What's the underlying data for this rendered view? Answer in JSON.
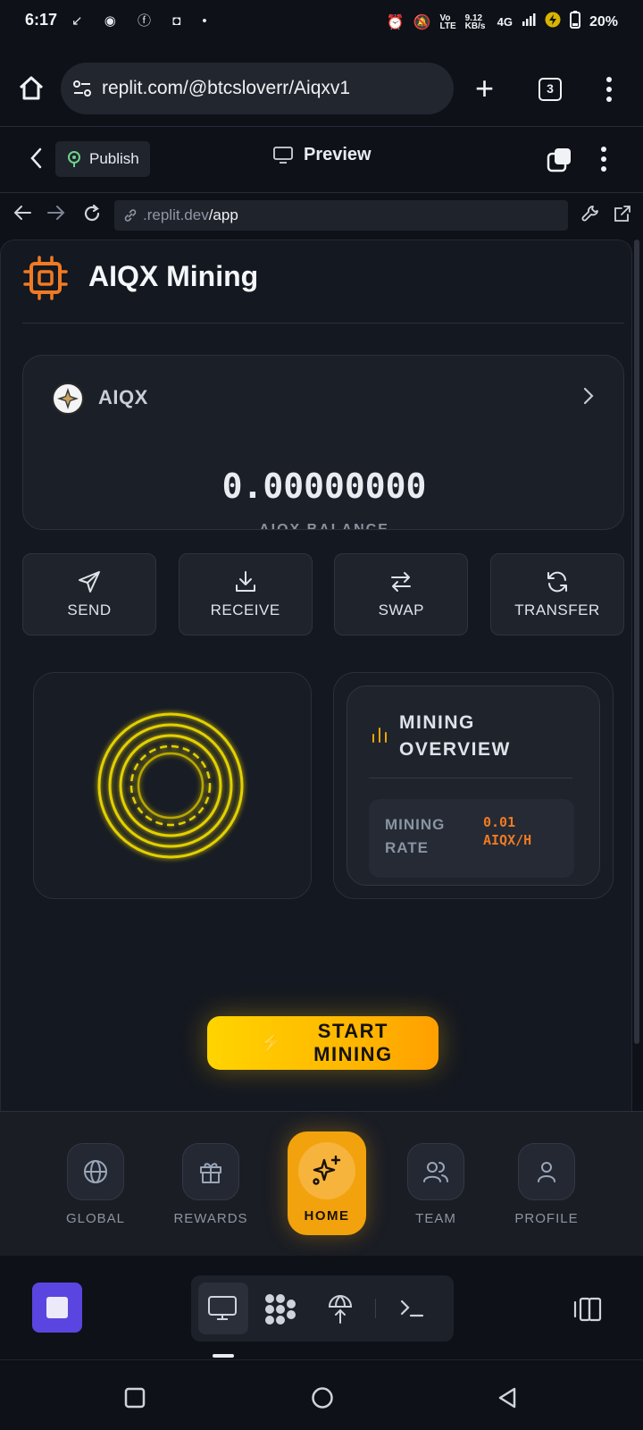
{
  "status_bar": {
    "time": "6:17",
    "battery": "20%",
    "net_speed": "9.12 KB/s",
    "network": "4G"
  },
  "browser": {
    "url": "replit.com/@btcsloverr/Aiqxv1",
    "tab_count": "3"
  },
  "replit_header": {
    "publish_label": "Publish",
    "preview_label": "Preview"
  },
  "webview": {
    "url_prefix": ".replit.dev",
    "url_path": "/app"
  },
  "app": {
    "title": "AIQX Mining",
    "balance": {
      "coin": "AIQX",
      "amount": "0.00000000",
      "label": "AIQX BALANCE"
    },
    "actions": [
      {
        "label": "SEND",
        "icon": "send-icon"
      },
      {
        "label": "RECEIVE",
        "icon": "download-icon"
      },
      {
        "label": "SWAP",
        "icon": "swap-icon"
      },
      {
        "label": "TRANSFER",
        "icon": "refresh-icon"
      }
    ],
    "overview": {
      "title": "MINING OVERVIEW",
      "rate_label": "MINING RATE",
      "rate_value": "0.01 AIQX/H"
    },
    "start_button": "START MINING",
    "accent": "#f2a20c",
    "ring_color": "#e3d000"
  },
  "bottom_nav": [
    {
      "label": "GLOBAL",
      "icon": "globe-icon"
    },
    {
      "label": "REWARDS",
      "icon": "gift-icon"
    },
    {
      "label": "HOME",
      "icon": "sparkles-icon",
      "active": true
    },
    {
      "label": "TEAM",
      "icon": "users-icon"
    },
    {
      "label": "PROFILE",
      "icon": "user-icon"
    }
  ]
}
